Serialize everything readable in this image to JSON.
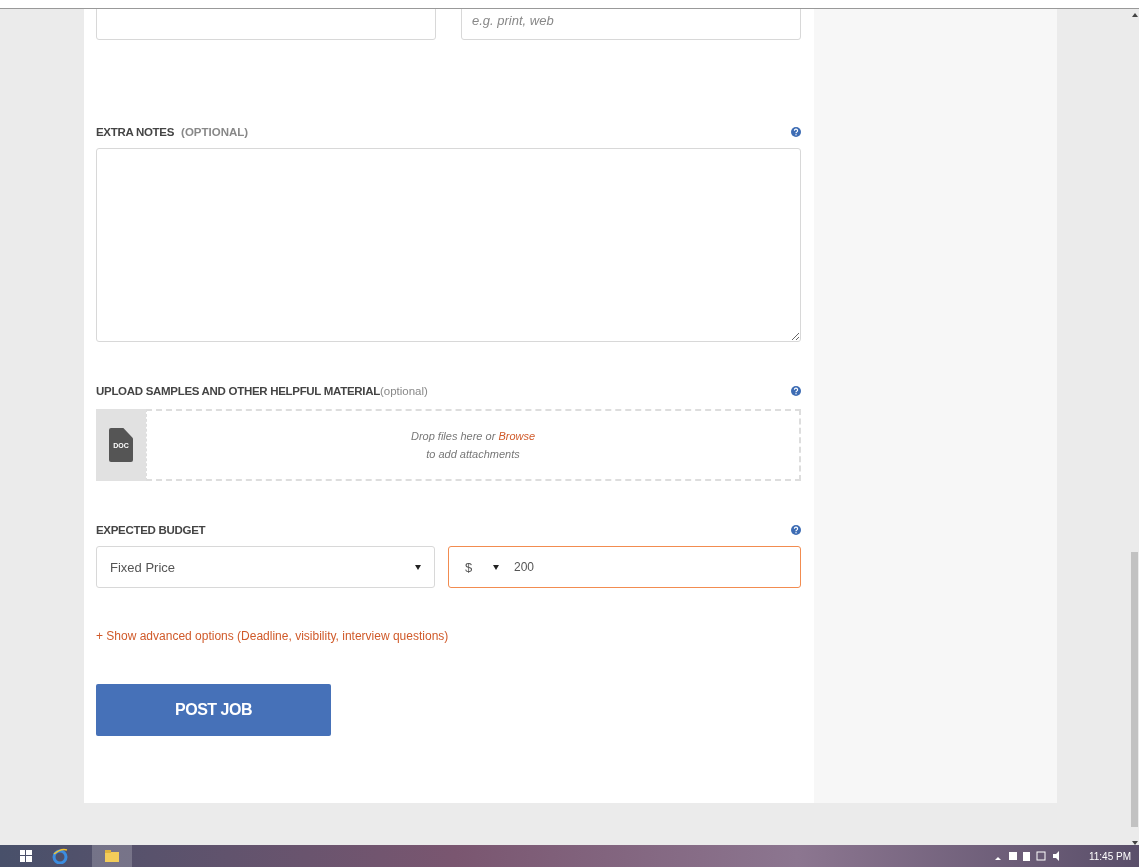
{
  "top_fields": [
    {
      "placeholder": "e.g. print, web"
    }
  ],
  "extra_notes": {
    "label": "EXTRA NOTES",
    "optional": "(OPTIONAL)"
  },
  "upload": {
    "label": "UPLOAD SAMPLES AND OTHER HELPFUL MATERIAL",
    "optional": "(optional)",
    "file_badge": "DOC",
    "drop_text": "Drop files here or",
    "browse": "Browse",
    "drop_text_2": "to add attachments"
  },
  "budget": {
    "label": "EXPECTED BUDGET",
    "type": "Fixed Price",
    "currency": "$",
    "amount": "200",
    "focused": true
  },
  "advanced_link": "+ Show advanced options (Deadline, visibility, interview questions)",
  "post_button": "POST JOB",
  "taskbar": {
    "time": "11:45 PM"
  }
}
